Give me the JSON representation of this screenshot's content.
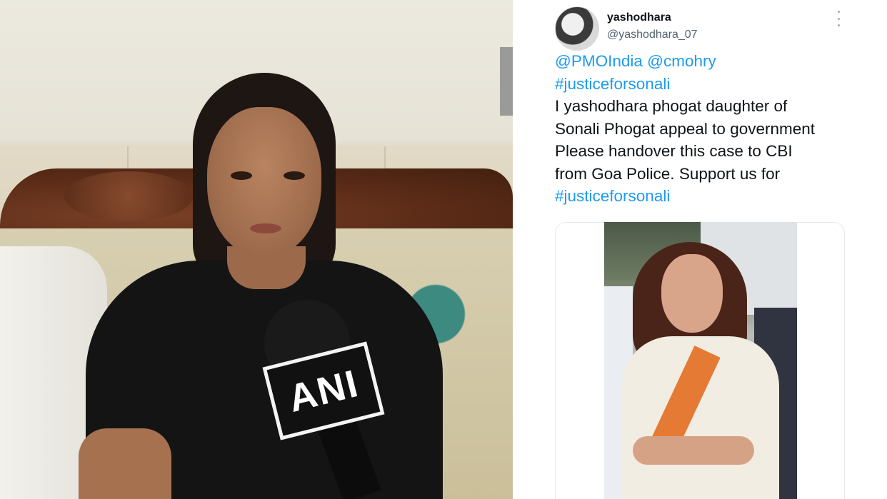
{
  "video": {
    "mic_flag_text": "ANI"
  },
  "tweet": {
    "display_name": "yashodhara",
    "handle": "@yashodhara_07",
    "mentions": [
      "@PMOIndia",
      "@cmohry"
    ],
    "hashtag": "#justiceforsonali",
    "text_lines": [
      "I yashodhara phogat daughter of",
      "Sonali Phogat appeal to government",
      "Please handover this case to CBI",
      "from Goa Police. Support us for"
    ],
    "closing_hashtag": "#justiceforsonali",
    "link_color": "#1d9bf0"
  }
}
